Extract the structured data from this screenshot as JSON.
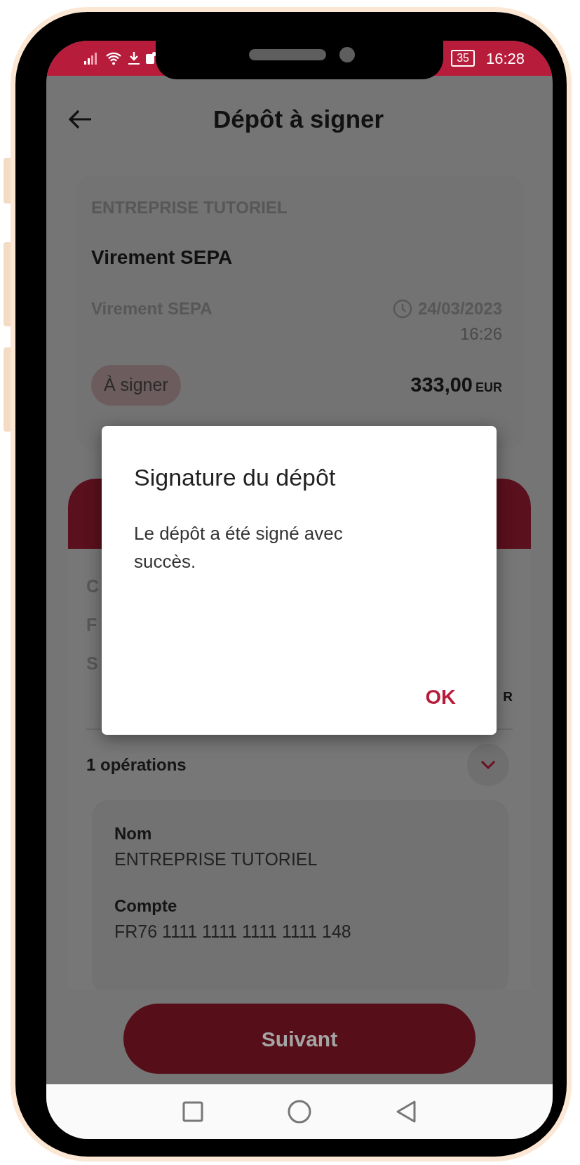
{
  "status_bar": {
    "battery": "35",
    "time": "16:28"
  },
  "header": {
    "title": "Dépôt à signer"
  },
  "summary": {
    "company": "ENTREPRISE TUTORIEL",
    "title": "Virement SEPA",
    "type": "Virement SEPA",
    "date": "24/03/2023",
    "time": "16:26",
    "status": "À signer",
    "amount": "333,00",
    "currency": "EUR"
  },
  "details_panel": {
    "covered_fragments": [
      "C",
      "F",
      "S"
    ],
    "amount_fragment": "R"
  },
  "operations": {
    "count_label": "1 opérations",
    "fields": [
      {
        "label": "Nom",
        "value": "ENTREPRISE TUTORIEL"
      },
      {
        "label": "Compte",
        "value": "FR76 1111 1111 1111 1111 148"
      }
    ]
  },
  "primary_button": "Suivant",
  "dialog": {
    "title": "Signature du dépôt",
    "message": "Le dépôt a été signé avec succès.",
    "button": "OK"
  }
}
